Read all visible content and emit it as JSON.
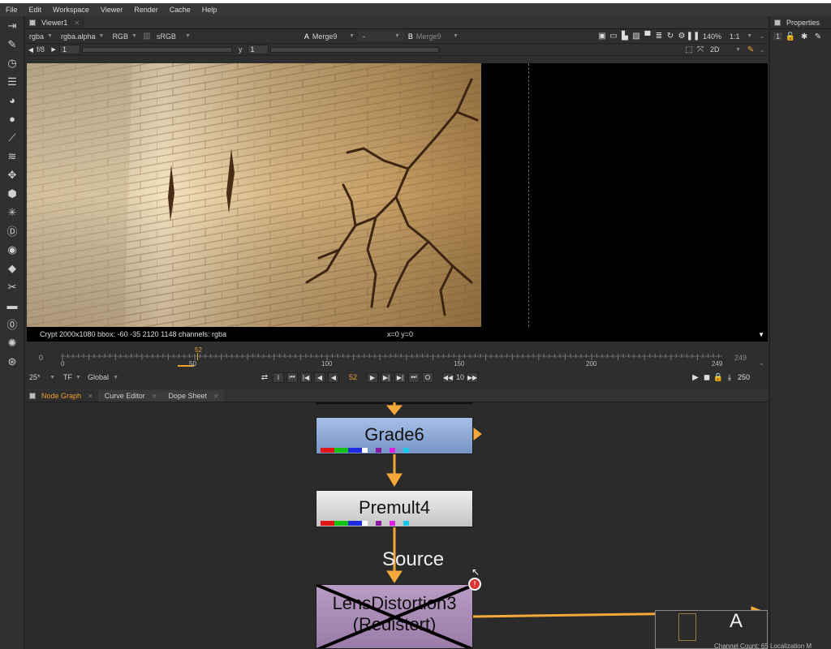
{
  "menu": [
    "File",
    "Edit",
    "Workspace",
    "Viewer",
    "Render",
    "Cache",
    "Help"
  ],
  "viewer": {
    "tab_label": "Viewer1",
    "layers": "rgba",
    "channels": "rgba.alpha",
    "display": "RGB",
    "colorspace": "sRGB",
    "input_a_letter": "A",
    "input_a": "Merge9",
    "operation": "-",
    "input_b_letter": "B",
    "input_b": "Merge9",
    "zoom": "140%",
    "proxy": "1:1",
    "fstop": "f/8",
    "gain": "1",
    "gamma_label": "y",
    "gamma": "1",
    "view_mode": "2D",
    "info_text": "Crypt 2000x1080  bbox: -60 -35 2120 1148 channels: rgba",
    "coords": "x=0 y=0"
  },
  "timeline": {
    "start": "0",
    "end": "249",
    "current": "52",
    "ticks": [
      "0",
      "50",
      "100",
      "150",
      "200",
      "249"
    ],
    "right_value": "249"
  },
  "playback": {
    "fps": "25*",
    "tf": "TF",
    "scope": "Global",
    "frame": "52",
    "step": "10",
    "end_frame": "250"
  },
  "properties": {
    "tab_label": "Properties",
    "count": "1"
  },
  "graph_tabs": [
    {
      "label": "Node Graph",
      "active": true
    },
    {
      "label": "Curve Editor",
      "active": false
    },
    {
      "label": "Dope Sheet",
      "active": false
    }
  ],
  "nodes": {
    "grade": "Grade6",
    "premult": "Premult4",
    "lens_line1": "LensDistortion3",
    "lens_line2": "(Redistort)",
    "source_label": "Source",
    "a_label": "A",
    "error_badge": "!"
  },
  "status_text": "Channel Count: 65  Localization M",
  "colors": {
    "accent": "#f0a030",
    "grade_node": "#8aa6d4",
    "premult_node": "#d7d7d7",
    "lens_node": "#a58ab1",
    "pipe": "#f5a93a"
  }
}
